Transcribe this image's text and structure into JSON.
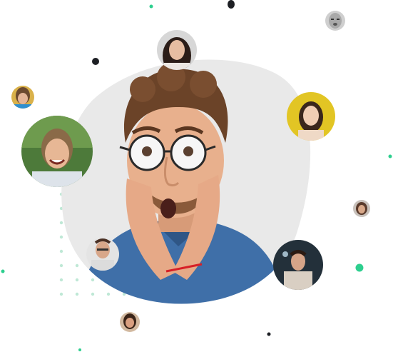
{
  "colors": {
    "background": "#ffffff",
    "blob": "#e9e9e9",
    "accent_green": "#2ecf8f",
    "dot_pattern": "#bfe8d6",
    "dark_dot": "#1d1f24",
    "shirt": "#3f6fa8",
    "hair": "#6b4328",
    "skin": "#e8b08d"
  },
  "hero": {
    "icon": "surprised-man-photo"
  },
  "avatars": [
    {
      "icon": "woman-dark-hair-portrait"
    },
    {
      "icon": "woman-bangs-portrait"
    },
    {
      "icon": "woman-smiling-bun-portrait"
    },
    {
      "icon": "woman-yellow-background-portrait"
    },
    {
      "icon": "woman-small-portrait"
    },
    {
      "icon": "man-glasses-portrait"
    },
    {
      "icon": "man-dark-background-portrait"
    },
    {
      "icon": "woman-bottom-portrait"
    },
    {
      "icon": "grayscale-face-portrait"
    }
  ]
}
